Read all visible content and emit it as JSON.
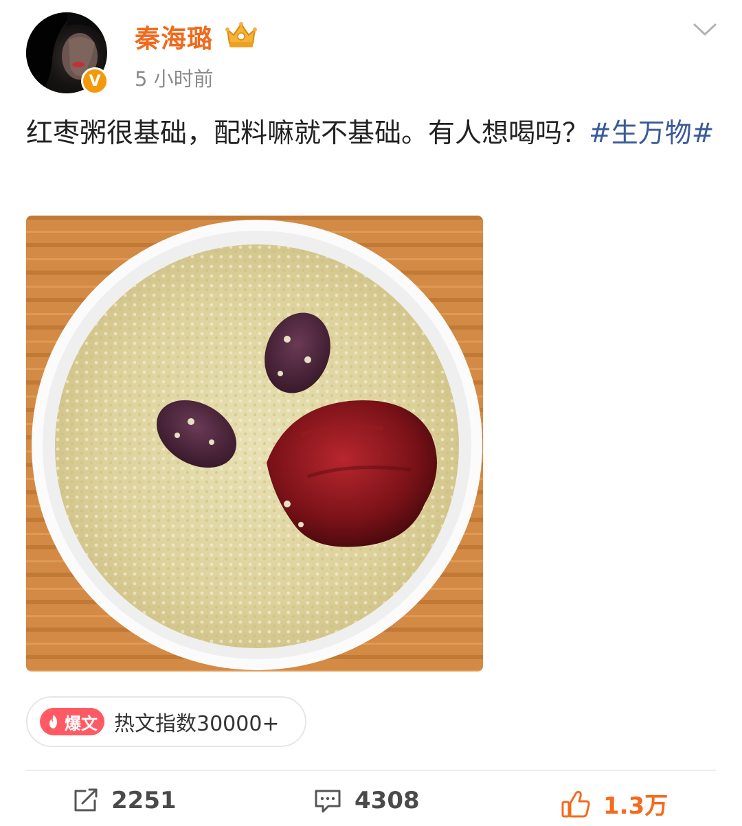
{
  "header": {
    "username": "秦海璐",
    "time": "5 小时前",
    "verified_icon": "v-verified-badge",
    "member_icon": "crown-member-icon",
    "menu_icon": "chevron-down-icon"
  },
  "post": {
    "text": "红枣粥很基础，配料嘛就不基础。有人想喝吗？",
    "hashtag": "#生万物#",
    "image_icon": "photo-millet-jujube-porridge"
  },
  "hot": {
    "badge_label": "爆文",
    "index_text": "热文指数30000+"
  },
  "actions": {
    "repost_count": "2251",
    "comment_count": "4308",
    "like_count": "1.3万"
  },
  "colors": {
    "username": "#f06a1d",
    "hashtag": "#3a5a9a",
    "like": "#f46b1e",
    "hot_badge": "#ff5a63"
  }
}
